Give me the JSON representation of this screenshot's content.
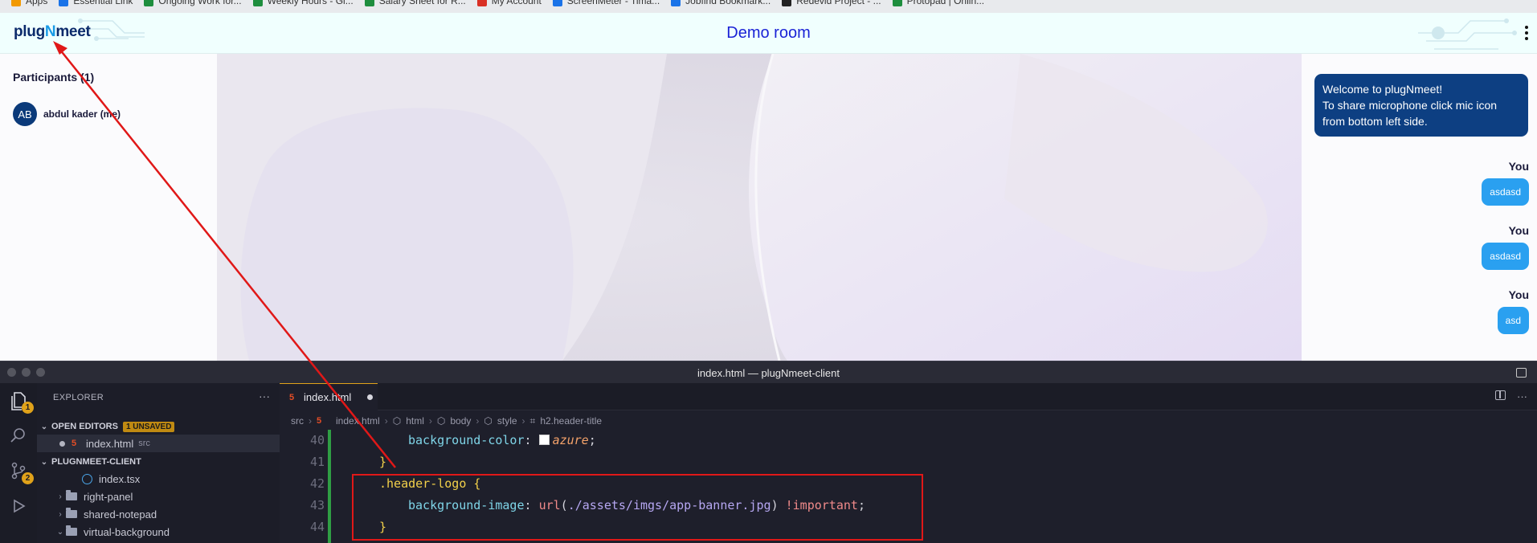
{
  "browser": {
    "bookmarks": [
      {
        "label": "Apps",
        "icon": "apps-grid-icon"
      },
      {
        "label": "Essential Link",
        "icon": "bookmark-favicon-icon"
      },
      {
        "label": "Ongoing Work for...",
        "icon": "sheets-icon"
      },
      {
        "label": "Weekly Hours - Gi...",
        "icon": "sheets-icon"
      },
      {
        "label": "Salary Sheet for R...",
        "icon": "sheets-icon"
      },
      {
        "label": "My Account",
        "icon": "bookmark-favicon-icon"
      },
      {
        "label": "ScreenMeter - Tima...",
        "icon": "bookmark-favicon-icon"
      },
      {
        "label": "Jobfind Bookmark...",
        "icon": "bookmark-favicon-icon"
      },
      {
        "label": "Redevid Project - ...",
        "icon": "bookmark-favicon-icon"
      },
      {
        "label": "Protopad | Onlin...",
        "icon": "bookmark-favicon-icon"
      }
    ]
  },
  "app": {
    "logo_prefix": "plug",
    "logo_n": "N",
    "logo_suffix": "meet",
    "room_title": "Demo room",
    "participants_title": "Participants (1)",
    "participants": [
      {
        "initials": "AB",
        "name": "abdul kader (me)"
      }
    ],
    "chat": {
      "welcome_line1": "Welcome to plugNmeet!",
      "welcome_line2": "To share microphone click mic icon from bottom left side.",
      "messages": [
        {
          "author": "You",
          "text": "asdasd"
        },
        {
          "author": "You",
          "text": "asdasd"
        },
        {
          "author": "You",
          "text": "asd"
        }
      ]
    }
  },
  "editor": {
    "window_title": "index.html — plugNmeet-client",
    "explorer_title": "EXPLORER",
    "open_editors_label": "OPEN EDITORS",
    "unsaved_badge": "1 UNSAVED",
    "open_file": "index.html",
    "open_file_dir": "src",
    "project_label": "PLUGNMEET-CLIENT",
    "tree": [
      {
        "label": "index.tsx",
        "type": "react"
      },
      {
        "label": "right-panel",
        "type": "folder"
      },
      {
        "label": "shared-notepad",
        "type": "folder"
      },
      {
        "label": "virtual-background",
        "type": "folder"
      }
    ],
    "activity_badges": {
      "explorer": "1",
      "scm": "2"
    },
    "tab_label": "index.html",
    "breadcrumb": [
      "src",
      "index.html",
      "html",
      "body",
      "style",
      "h2.header-title"
    ],
    "line_numbers": [
      "40",
      "41",
      "42",
      "43",
      "44"
    ],
    "code": {
      "l40_prop": "background-color",
      "l40_val": "azure",
      "l42_sel": ".header-logo",
      "l43_prop": "background-image",
      "l43_func": "url",
      "l43_path": "./assets/imgs/app-banner.jpg",
      "l43_imp": "!important"
    }
  }
}
